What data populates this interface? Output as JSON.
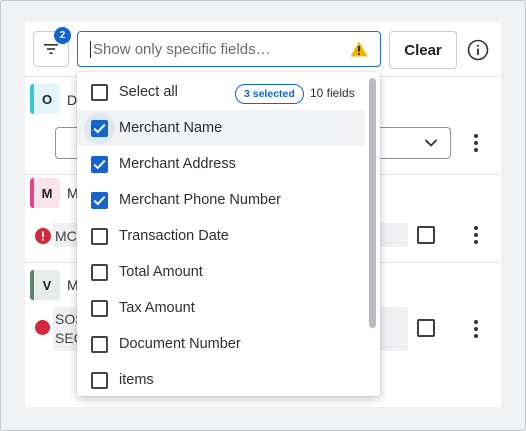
{
  "toolbar": {
    "filter_badge": "2",
    "search_placeholder": "Show only specific fields…",
    "clear_label": "Clear"
  },
  "rows": [
    {
      "avatar": "O",
      "peek": "D"
    },
    {
      "avatar": "M",
      "peek": "M",
      "peek_text": "MC"
    },
    {
      "avatar": "V",
      "peek": "M",
      "peek_text_1": "SOS",
      "peek_text_2": "SEC"
    }
  ],
  "dropdown": {
    "select_all_label": "Select all",
    "selected_badge": "3 selected",
    "fields_count": "10 fields",
    "options": [
      {
        "label": "Merchant Name",
        "checked": true
      },
      {
        "label": "Merchant Address",
        "checked": true
      },
      {
        "label": "Merchant Phone Number",
        "checked": true
      },
      {
        "label": "Transaction Date",
        "checked": false
      },
      {
        "label": "Total Amount",
        "checked": false
      },
      {
        "label": "Tax Amount",
        "checked": false
      },
      {
        "label": "Document Number",
        "checked": false
      },
      {
        "label": "items",
        "checked": false
      }
    ]
  },
  "colors": {
    "accent": "#1463cf",
    "warning": "#f0b400",
    "error": "#d6263a"
  }
}
